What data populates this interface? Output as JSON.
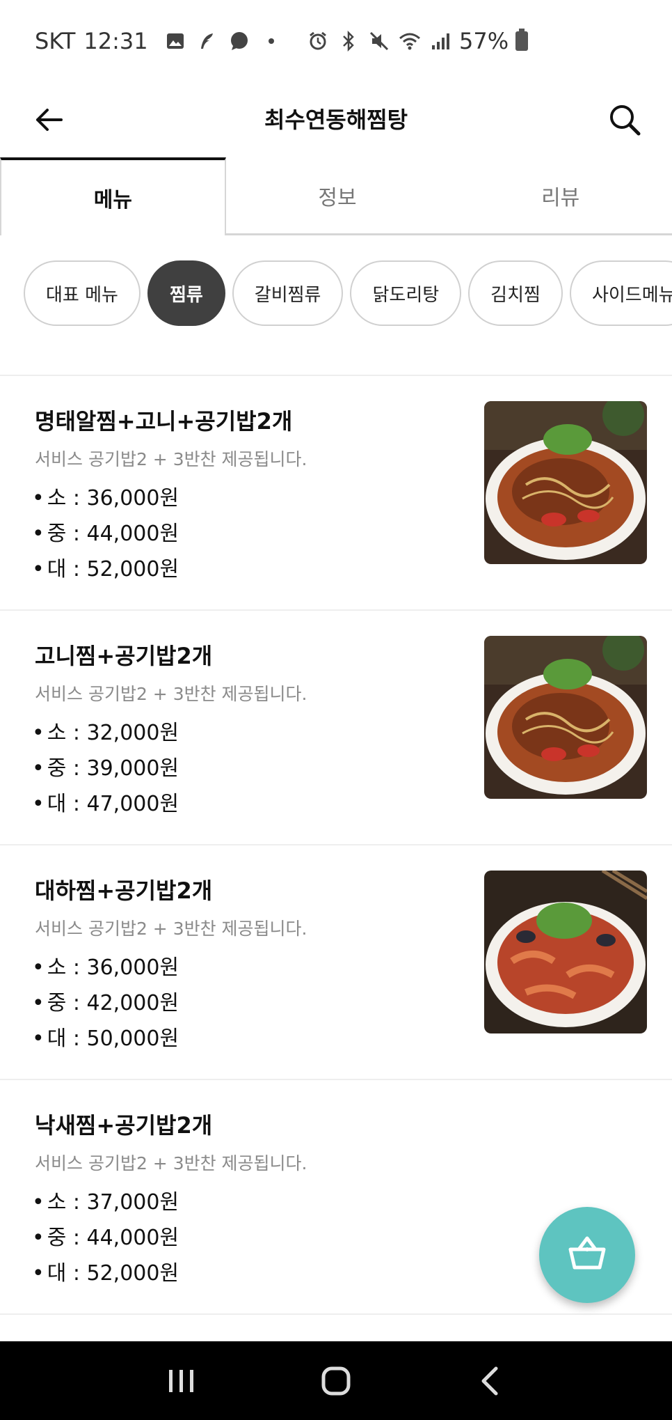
{
  "status_bar": {
    "carrier": "SKT",
    "time": "12:31",
    "battery": "57%",
    "icons": [
      "gallery-icon",
      "feather-icon",
      "chat-icon",
      "dot-icon",
      "alarm-icon",
      "bluetooth-icon",
      "mute-icon",
      "wifi-icon",
      "signal-icon",
      "battery-icon"
    ]
  },
  "header": {
    "title": "최수연동해찜탕",
    "back_icon": "arrow-left-icon",
    "search_icon": "search-icon"
  },
  "tabs": [
    {
      "label": "메뉴",
      "active": true
    },
    {
      "label": "정보",
      "active": false
    },
    {
      "label": "리뷰",
      "active": false
    }
  ],
  "categories": [
    {
      "label": "대표 메뉴",
      "active": false
    },
    {
      "label": "찜류",
      "active": true
    },
    {
      "label": "갈비찜류",
      "active": false
    },
    {
      "label": "닭도리탕",
      "active": false
    },
    {
      "label": "김치찜",
      "active": false
    },
    {
      "label": "사이드메뉴",
      "active": false
    }
  ],
  "menu_items": [
    {
      "name": "명태알찜+고니+공기밥2개",
      "description": "서비스 공기밥2 + 3반찬 제공됩니다.",
      "prices": [
        "소 : 36,000원",
        "중 : 44,000원",
        "대 : 52,000원"
      ],
      "has_photo": true
    },
    {
      "name": "고니찜+공기밥2개",
      "description": "서비스 공기밥2 + 3반찬 제공됩니다.",
      "prices": [
        "소 : 32,000원",
        "중 : 39,000원",
        "대 : 47,000원"
      ],
      "has_photo": true
    },
    {
      "name": "대하찜+공기밥2개",
      "description": "서비스 공기밥2 + 3반찬 제공됩니다.",
      "prices": [
        "소 : 36,000원",
        "중 : 42,000원",
        "대 : 50,000원"
      ],
      "has_photo": true
    },
    {
      "name": "낙새찜+공기밥2개",
      "description": "서비스 공기밥2 + 3반찬 제공됩니다.",
      "prices": [
        "소 : 37,000원",
        "중 : 44,000원",
        "대 : 52,000원"
      ],
      "has_photo": false
    }
  ],
  "cart": {
    "icon": "shopping-basket-icon"
  },
  "nav": {
    "icons": [
      "recent-apps-icon",
      "home-icon",
      "back-icon"
    ]
  },
  "colors": {
    "accent": "#5ec4c0",
    "chip_active": "#404040",
    "nav_bg": "#000000"
  }
}
